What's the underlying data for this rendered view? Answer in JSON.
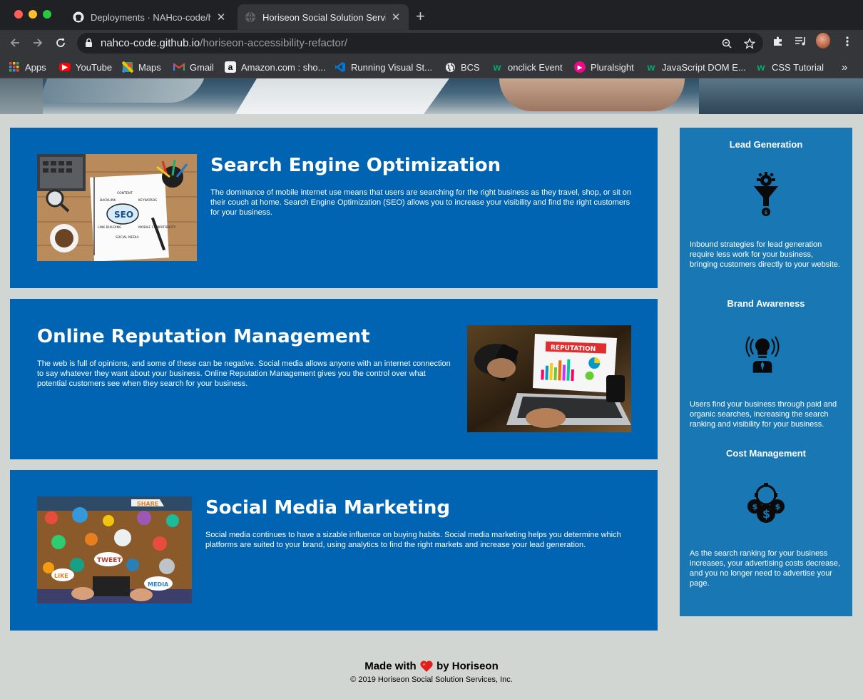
{
  "browser": {
    "tabs": [
      {
        "label": "Deployments · NAHco-code/ho",
        "icon": "github-icon",
        "active": false
      },
      {
        "label": "Horiseon Social Solution Servic",
        "icon": "globe-icon",
        "active": true
      }
    ],
    "address": {
      "host": "nahco-code.github.io",
      "path": "/horiseon-accessibility-refactor/"
    },
    "bookmarks": [
      {
        "label": "Apps",
        "icon": "apps-grid-icon"
      },
      {
        "label": "YouTube",
        "icon": "youtube-icon",
        "color": "#ff0000"
      },
      {
        "label": "Maps",
        "icon": "maps-icon"
      },
      {
        "label": "Gmail",
        "icon": "gmail-icon"
      },
      {
        "label": "Amazon.com : sho...",
        "icon": "amazon-icon"
      },
      {
        "label": "Running Visual St...",
        "icon": "vscode-icon",
        "color": "#0078d4"
      },
      {
        "label": "BCS",
        "icon": "globe-icon"
      },
      {
        "label": "onclick Event",
        "icon": "w3schools-icon",
        "color": "#04aa6d"
      },
      {
        "label": "Pluralsight",
        "icon": "pluralsight-icon",
        "color": "#e80a89"
      },
      {
        "label": "JavaScript DOM E...",
        "icon": "w3schools-icon",
        "color": "#04aa6d"
      },
      {
        "label": "CSS Tutorial",
        "icon": "w3schools-icon",
        "color": "#04aa6d"
      }
    ]
  },
  "content": [
    {
      "title": "Search Engine Optimization",
      "text": "The dominance of mobile internet use means that users are searching for the right business as they travel, shop, or sit on their couch at home. Search Engine Optimization (SEO) allows you to increase your visibility and find the right customers for your business.",
      "image": "seo-notebook-image",
      "image_words": [
        "SEO",
        "CONTENT",
        "BACKLINK",
        "KEYWORDS",
        "LINK BUILDING",
        "SOCIAL MEDIA",
        "MOBILE COMPATIBILITY"
      ]
    },
    {
      "title": "Online Reputation Management",
      "text": "The web is full of opinions, and some of these can be negative. Social media allows anyone with an internet connection to say whatever they want about your business. Online Reputation Management gives you the control over what potential customers see when they search for your business.",
      "image": "reputation-laptop-image",
      "image_words": [
        "REPUTATION"
      ]
    },
    {
      "title": "Social Media Marketing",
      "text": "Social media continues to have a sizable influence on buying habits. Social media marketing helps you determine which platforms are suited to your brand, using analytics to find the right markets and increase your lead generation.",
      "image": "social-media-table-image",
      "image_words": [
        "SHARE",
        "TWEET",
        "LIKE",
        "MEDIA"
      ]
    }
  ],
  "benefits": [
    {
      "title": "Lead Generation",
      "icon": "lead-funnel-icon",
      "text": "Inbound strategies for lead generation require less work for your business, bringing customers directly to your website."
    },
    {
      "title": "Brand Awareness",
      "icon": "brand-lightbulb-icon",
      "text": "Users find your business through paid and organic searches, increasing the search ranking and visibility for your business."
    },
    {
      "title": "Cost Management",
      "icon": "cost-coins-icon",
      "text": "As the search ranking for your business increases, your advertising costs decrease, and you no longer need to advertise your page."
    }
  ],
  "footer": {
    "made_prefix": "Made with",
    "made_suffix": "by Horiseon",
    "copyright": "© 2019 Horiseon Social Solution Services, Inc."
  },
  "colors": {
    "content_card": "#0064b2",
    "sidebar": "#1978b4",
    "page_bg": "#d1d6d2",
    "heart": "#e0201b"
  }
}
